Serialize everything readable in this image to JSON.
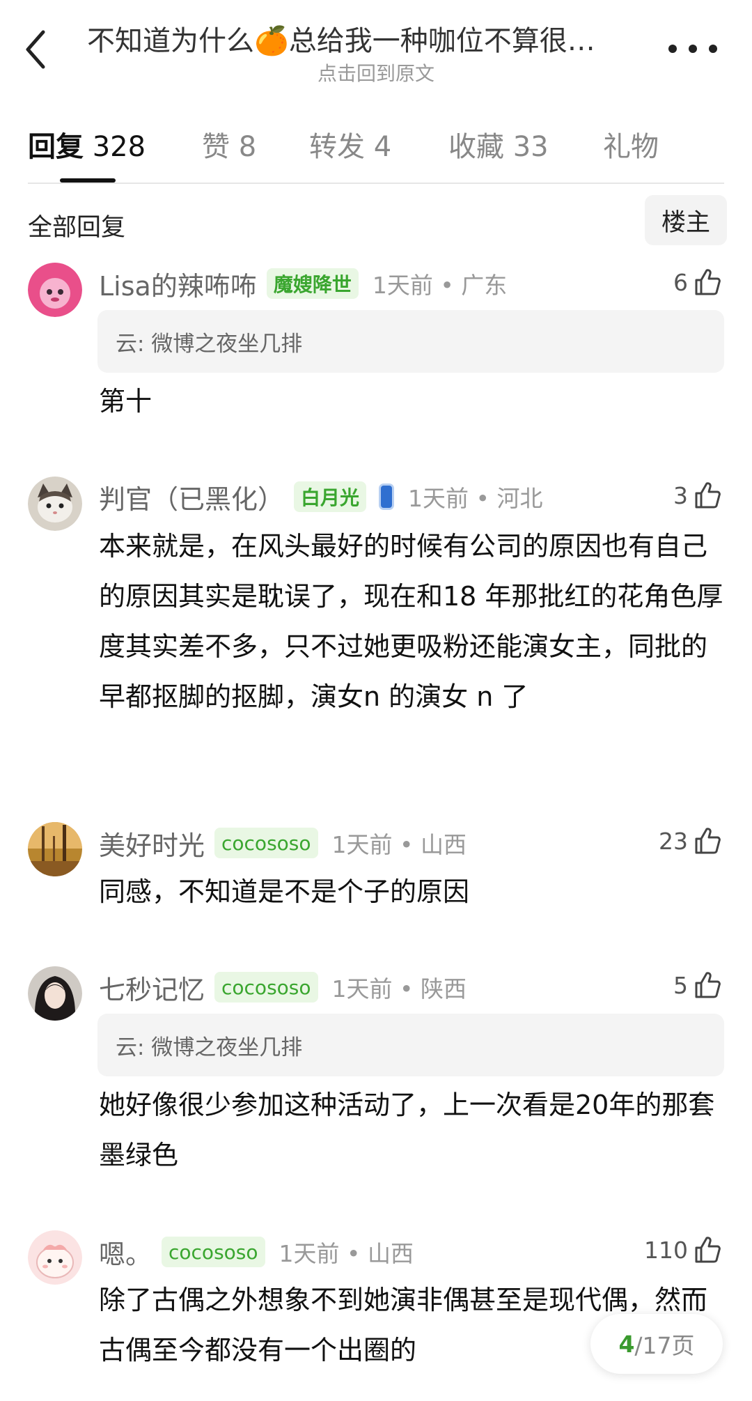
{
  "header": {
    "title": "不知道为什么🍊总给我一种咖位不算很…",
    "subtitle": "点击回到原文"
  },
  "tabs": [
    {
      "name": "回复",
      "count": "328"
    },
    {
      "name": "赞",
      "count": "8"
    },
    {
      "name": "转发",
      "count": "4"
    },
    {
      "name": "收藏",
      "count": "33"
    },
    {
      "name": "礼物",
      "count": ""
    }
  ],
  "section": {
    "title": "全部回复",
    "op_button": "楼主"
  },
  "comments": [
    {
      "username": "Lisa的辣咘咘",
      "badge": "魔嫂降世",
      "time_location": "1天前 • 广东",
      "likes": "6",
      "quote": "云: 微博之夜坐几排",
      "text": "第十"
    },
    {
      "username": "判官（已黑化）",
      "badge": "白月光",
      "time_location": "1天前 • 河北",
      "likes": "3",
      "quote": "",
      "text": "本来就是，在风头最好的时候有公司的原因也有自己的原因其实是耽误了，现在和18 年那批红的花角色厚度其实差不多，只不过她更吸粉还能演女主，同批的早都抠脚的抠脚，演女n 的演女 n 了"
    },
    {
      "username": "美好时光",
      "badge": "cocososo",
      "time_location": "1天前 • 山西",
      "likes": "23",
      "quote": "",
      "text": "同感，不知道是不是个子的原因"
    },
    {
      "username": "七秒记忆",
      "badge": "cocososo",
      "time_location": "1天前 • 陕西",
      "likes": "5",
      "quote": "云: 微博之夜坐几排",
      "text": "她好像很少参加这种活动了，上一次看是20年的那套墨绿色"
    },
    {
      "username": "嗯。",
      "badge": "cocososo",
      "time_location": "1天前 • 山西",
      "likes": "110",
      "quote": "",
      "text": "除了古偶之外想象不到她演非偶甚至是现代偶，然而古偶至今都没有一个出圈的"
    }
  ],
  "pager": {
    "current": "4",
    "total_label": "/17页"
  },
  "colors": {
    "badge_green": "#3aa62f",
    "badge_bg": "#e9f7e4",
    "pager_current": "#3a9a2e"
  },
  "icons": [
    "back-arrow-icon",
    "more-dots-icon",
    "thumbs-up-icon",
    "blue-sticker-icon"
  ]
}
